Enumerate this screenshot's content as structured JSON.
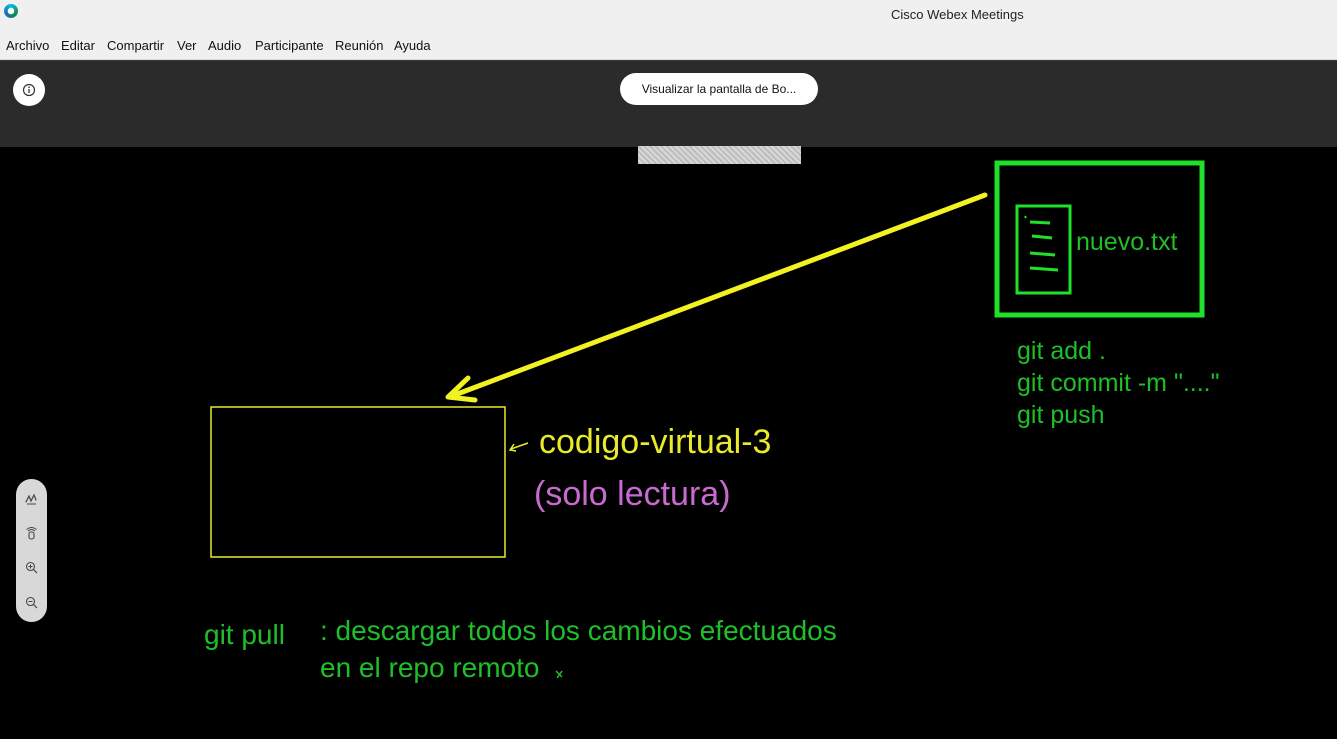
{
  "window": {
    "title": "Cisco Webex Meetings",
    "logo_icon": "webex-logo-icon"
  },
  "menu": {
    "items": [
      {
        "label": "Archivo"
      },
      {
        "label": "Editar"
      },
      {
        "label": "Compartir"
      },
      {
        "label": "Ver"
      },
      {
        "label": "Audio"
      },
      {
        "label": "Participante"
      },
      {
        "label": "Reunión"
      },
      {
        "label": "Ayuda"
      }
    ]
  },
  "meeting": {
    "share_button_label": "Visualizar la pantalla de Bo...",
    "info_icon": "info-icon"
  },
  "board": {
    "file_label": "nuevo.txt",
    "git_commands": [
      "git add .",
      "git commit -m \"....\"",
      "git push"
    ],
    "repo_label": "codigo-virtual-3",
    "readonly_label": "(solo lectura)",
    "pull_label": "git pull",
    "pull_desc": [
      ": descargar todos los cambios efectuados",
      "en el repo remoto"
    ],
    "colors": {
      "background": "#000000",
      "green": "#1fbf2a",
      "yellow": "#e8ea2a",
      "pink": "#c86bd1"
    }
  },
  "toolbar": {
    "tools": [
      "annotate-pen-icon",
      "pointer-icon",
      "zoom-in-icon",
      "zoom-out-icon"
    ]
  }
}
